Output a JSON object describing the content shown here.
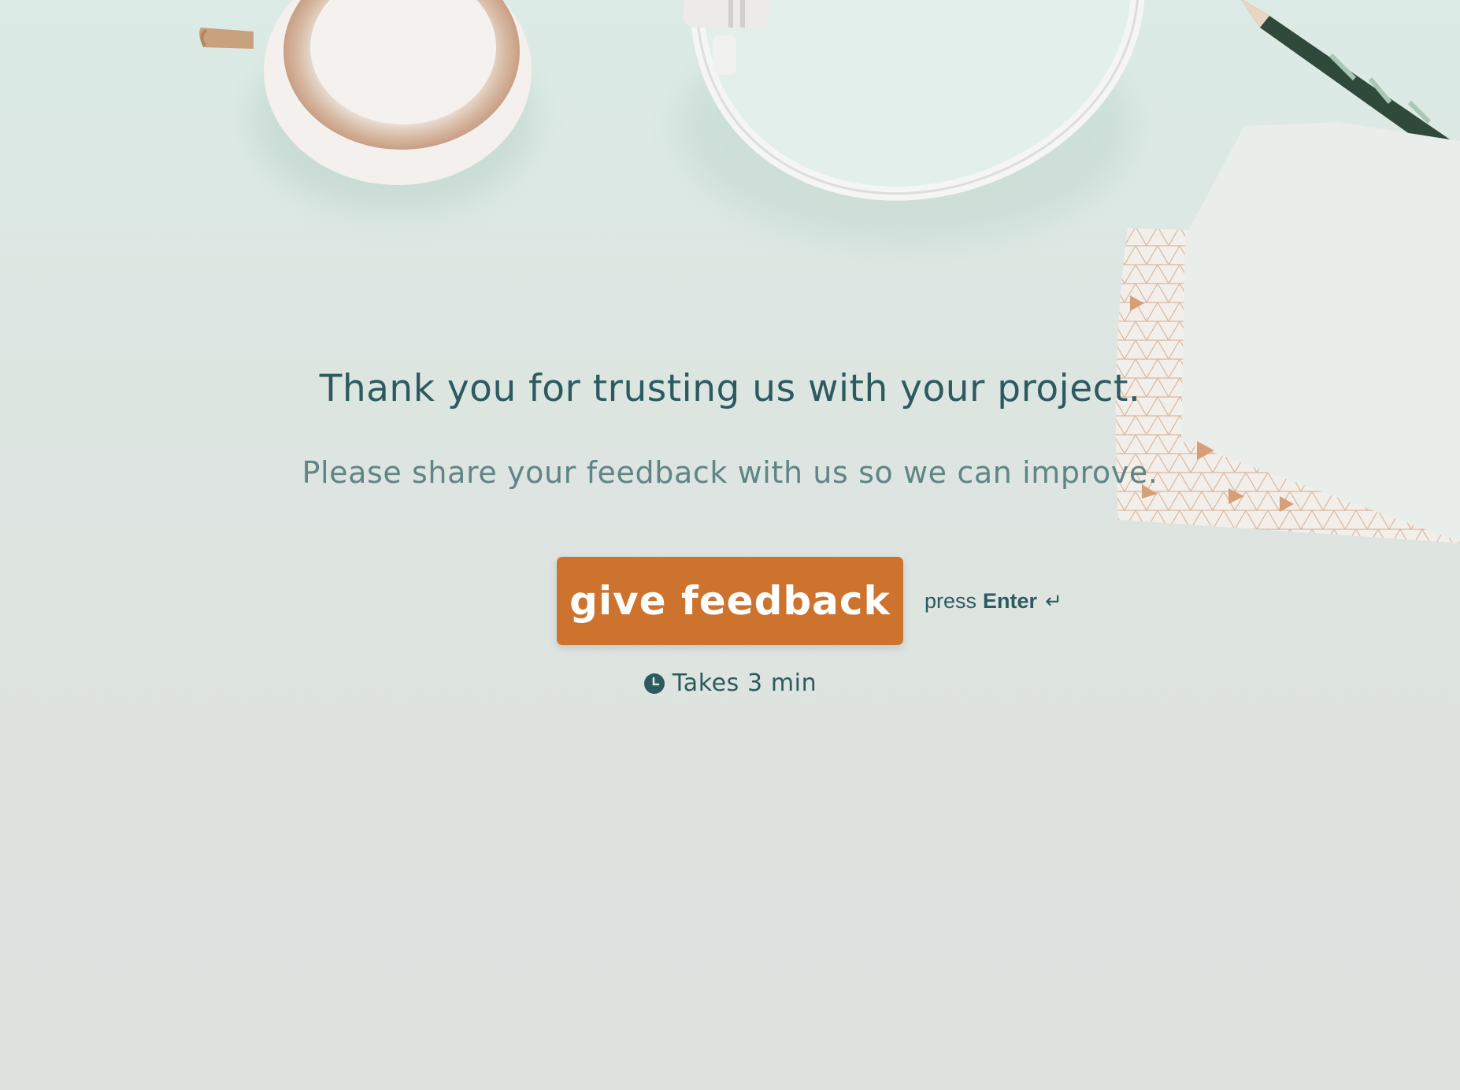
{
  "welcome": {
    "headline": "Thank you for trusting us with your project.",
    "subline": "Please share your feedback with us so we can improve.",
    "cta_label": "give feedback",
    "enter_prefix": "press",
    "enter_key": "Enter",
    "enter_glyph": "↵",
    "duration": "Takes 3 min"
  },
  "background": {
    "description_icons": [
      "coffee-cup-icon",
      "headphones-icon",
      "pencil-icon",
      "notebook-icon"
    ]
  },
  "colors": {
    "accent": "#cd732d",
    "text_primary": "#2c5b5f",
    "text_secondary": "#5f8586",
    "background": "#dee3e0"
  }
}
